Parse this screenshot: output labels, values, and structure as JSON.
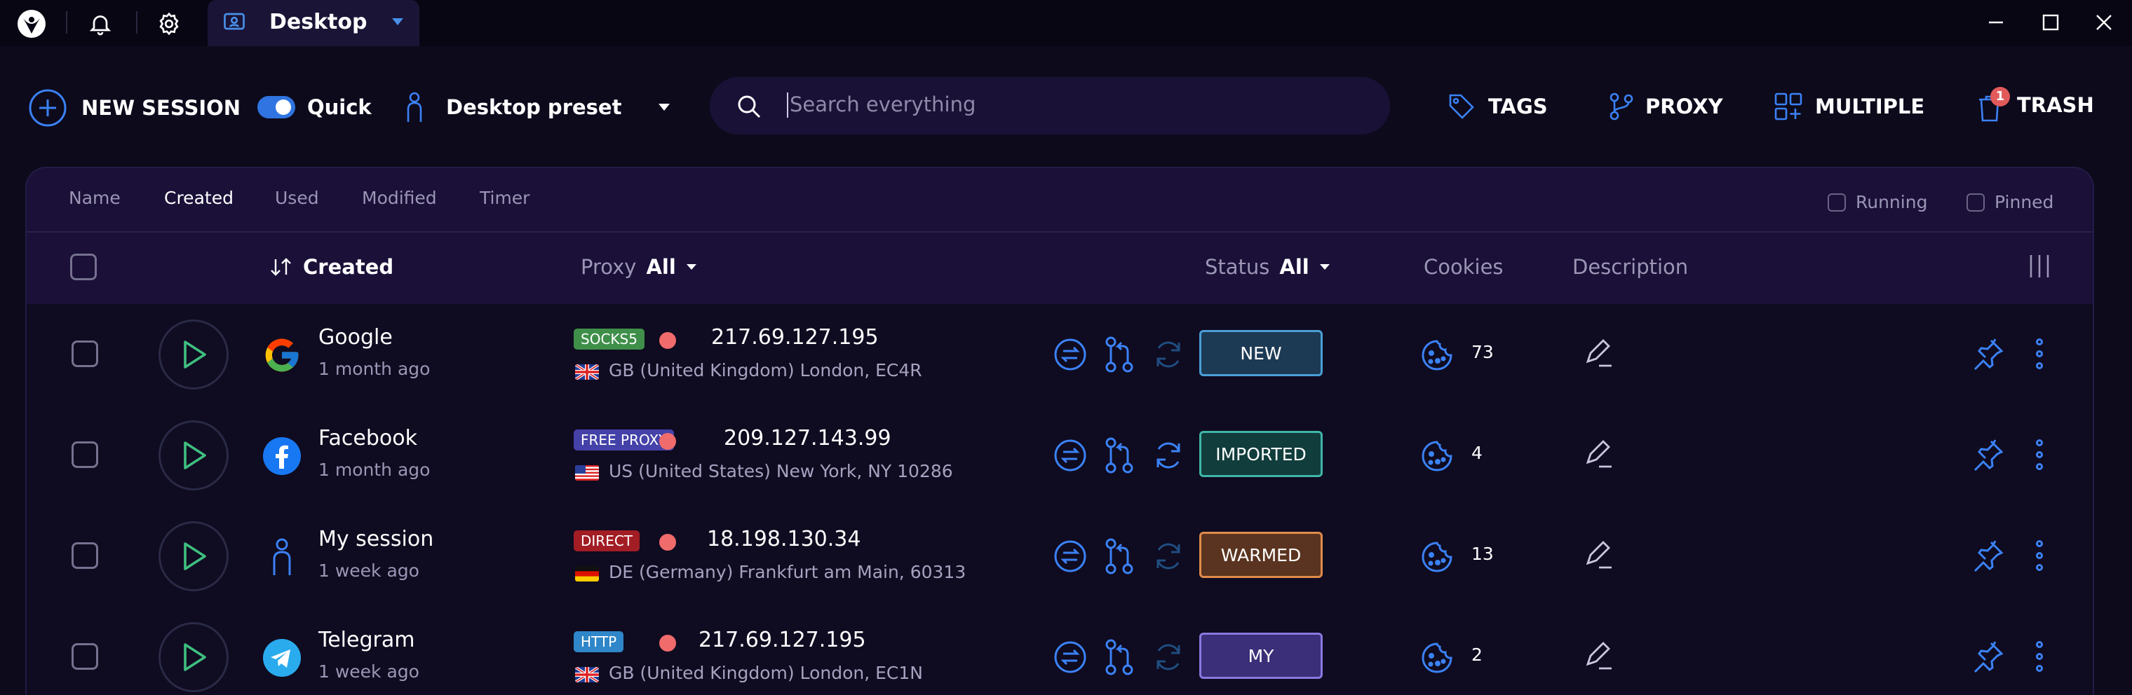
{
  "titlebar": {
    "tab_title": "Desktop",
    "icons": [
      "app-logo-icon",
      "bell-icon",
      "gear-icon",
      "desktop-profile-icon",
      "chevron-down-icon",
      "minimize-icon",
      "maximize-icon",
      "close-icon"
    ]
  },
  "toolbar": {
    "new_session_label": "NEW SESSION",
    "quick_label": "Quick",
    "quick_enabled": true,
    "preset_label": "Desktop preset",
    "search_placeholder": "Search everything",
    "tags_label": "TAGS",
    "proxy_label": "PROXY",
    "multiple_label": "MULTIPLE",
    "trash_label": "TRASH",
    "trash_badge": "1"
  },
  "sortbar": {
    "items": [
      "Name",
      "Created",
      "Used",
      "Modified",
      "Timer"
    ],
    "active": "Created",
    "filters": [
      "Running",
      "Pinned"
    ]
  },
  "header": {
    "created_label": "Created",
    "proxy_label": "Proxy",
    "proxy_value": "All",
    "status_label": "Status",
    "status_value": "All",
    "cookies_label": "Cookies",
    "description_label": "Description"
  },
  "rows": [
    {
      "name": "Google",
      "age": "1 month ago",
      "logo": "google-logo-icon",
      "proxy_type": "SOCKS5",
      "proxy_color": "#3f8f4a",
      "ip": "217.69.127.195",
      "flag": "gb-flag-icon",
      "location": "GB (United Kingdom) London, EC4R",
      "status": "NEW",
      "status_color": "#4a9fd6",
      "status_bg": "#1d3a55",
      "cookies": "73",
      "refresh_active": false
    },
    {
      "name": "Facebook",
      "age": "1 month ago",
      "logo": "facebook-logo-icon",
      "proxy_type": "FREE PROXY",
      "proxy_color": "#4442a8",
      "ip": "209.127.143.99",
      "flag": "us-flag-icon",
      "location": "US (United States) New York, NY 10286",
      "status": "IMPORTED",
      "status_color": "#3fb6a8",
      "status_bg": "#113d3c",
      "cookies": "4",
      "refresh_active": true
    },
    {
      "name": "My session",
      "age": "1 week ago",
      "logo": "person-icon",
      "proxy_type": "DIRECT",
      "proxy_color": "#a21d24",
      "ip": "18.198.130.34",
      "flag": "de-flag-icon",
      "location": "DE (Germany) Frankfurt am Main, 60313",
      "status": "WARMED",
      "status_color": "#e08b4a",
      "status_bg": "#5a3420",
      "cookies": "13",
      "refresh_active": false
    },
    {
      "name": "Telegram",
      "age": "1 week ago",
      "logo": "telegram-logo-icon",
      "proxy_type": "HTTP",
      "proxy_color": "#2f86c8",
      "ip": "217.69.127.195",
      "flag": "gb-flag-icon",
      "location": "GB (United Kingdom) London, EC1N",
      "status": "MY",
      "status_color": "#8a78e0",
      "status_bg": "#3a2f78",
      "cookies": "2",
      "refresh_active": false
    }
  ],
  "colors": {
    "accent": "#3b82f6",
    "bg": "#0d0a1c",
    "panel": "#0f0b20",
    "header": "#1a1038"
  }
}
